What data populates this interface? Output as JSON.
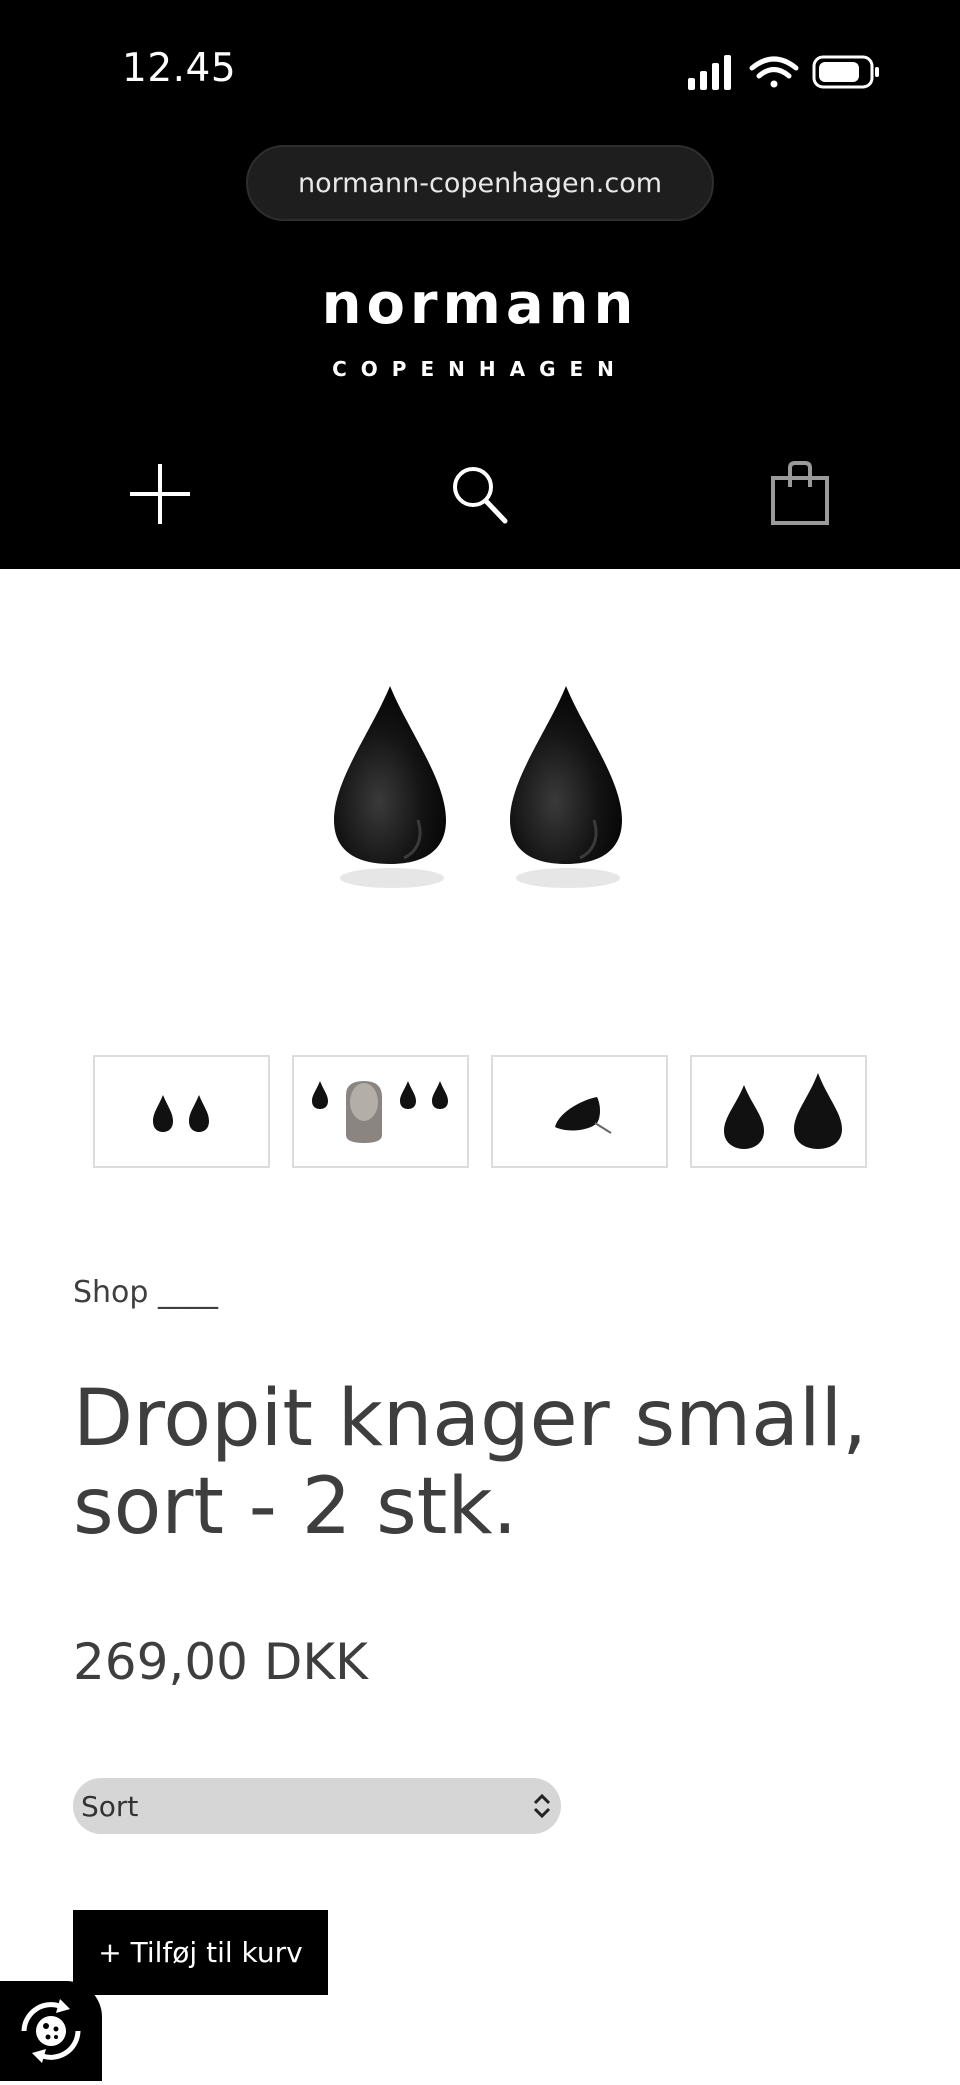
{
  "status_bar": {
    "time": "12.45"
  },
  "browser": {
    "url": "normann-copenhagen.com"
  },
  "brand": {
    "name": "normann",
    "subtitle": "COPENHAGEN"
  },
  "nav": {
    "menu_icon": "plus-menu-icon",
    "search_icon": "search-icon",
    "cart_icon": "shopping-bag-icon"
  },
  "product": {
    "breadcrumb": "Shop ____",
    "title_line1": "Dropit knager small,",
    "title_line2": "sort - 2 stk.",
    "price": "269,00 DKK",
    "color_option": "Sort",
    "add_to_cart": "+ Tilføj til kurv"
  },
  "colors": {
    "header_bg": "#000000",
    "text": "#3e3e3e",
    "select_bg": "#d6d6d6",
    "button_bg": "#000000"
  }
}
